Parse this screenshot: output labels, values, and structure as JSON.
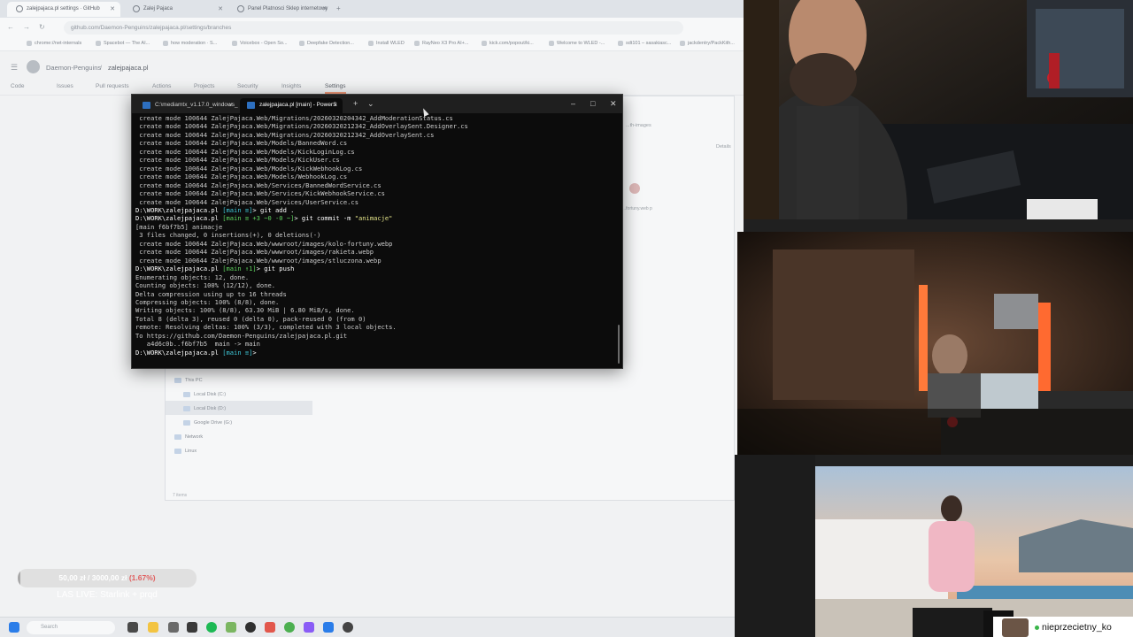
{
  "browser": {
    "tabs": [
      {
        "label": "zalejpajaca.pl settings · GitHub"
      },
      {
        "label": "Zalej Pajaca"
      },
      {
        "label": "Panel Platnosci Sklep internetowy"
      }
    ],
    "url": "github.com/Daemon-Penguins/zalejpajaca.pl/settings/branches",
    "bookmarks": [
      {
        "label": "chrome://net-internals"
      },
      {
        "label": "Spacebot — The AI..."
      },
      {
        "label": "how moderation · S..."
      },
      {
        "label": "Voicebox - Open So..."
      },
      {
        "label": "Deepfake Detection..."
      },
      {
        "label": "Install WLED"
      },
      {
        "label": "RayNeo X3 Pro AI+..."
      },
      {
        "label": "kick.com/popout/ki..."
      },
      {
        "label": "Welcome to WLED -..."
      },
      {
        "label": "sdt101 – sasakiasc..."
      },
      {
        "label": "jackdentry/PackKith..."
      }
    ],
    "repo": {
      "owner": "Daemon-Penguins",
      "name": "zalejpajaca.pl"
    },
    "repo_nav": [
      {
        "label": "Code"
      },
      {
        "label": "Issues"
      },
      {
        "label": "Pull requests"
      },
      {
        "label": "Actions"
      },
      {
        "label": "Projects"
      },
      {
        "label": "Security"
      },
      {
        "label": "Insights"
      },
      {
        "label": "Settings"
      }
    ]
  },
  "explorer": {
    "tree": [
      {
        "label": "This PC"
      },
      {
        "label": "Local Disk (C:)"
      },
      {
        "label": "Local Disk (D:)"
      },
      {
        "label": "Google Drive (G:)"
      },
      {
        "label": "Network"
      },
      {
        "label": "Linux"
      }
    ],
    "status": "7 items",
    "side_label": "Details",
    "header_label": "...th-images",
    "file_label": "...fortuny.web p"
  },
  "terminal": {
    "tabs": [
      {
        "label": "C:\\mediamtx_v1.17.0_windows_"
      },
      {
        "label": "zalejpajaca.pl [main] - PowerS"
      }
    ],
    "lines": [
      {
        "segs": [
          {
            "t": " create mode 100644 ZalejPajaca.Web/Migrations/20260320204342_AddModerationStatus.cs",
            "c": ""
          }
        ]
      },
      {
        "segs": [
          {
            "t": " create mode 100644 ZalejPajaca.Web/Migrations/20260320212342_AddOverlaySent.Designer.cs",
            "c": ""
          }
        ]
      },
      {
        "segs": [
          {
            "t": " create mode 100644 ZalejPajaca.Web/Migrations/20260320212342_AddOverlaySent.cs",
            "c": ""
          }
        ]
      },
      {
        "segs": [
          {
            "t": " create mode 100644 ZalejPajaca.Web/Models/BannedWord.cs",
            "c": ""
          }
        ]
      },
      {
        "segs": [
          {
            "t": " create mode 100644 ZalejPajaca.Web/Models/KickLoginLog.cs",
            "c": ""
          }
        ]
      },
      {
        "segs": [
          {
            "t": " create mode 100644 ZalejPajaca.Web/Models/KickUser.cs",
            "c": ""
          }
        ]
      },
      {
        "segs": [
          {
            "t": " create mode 100644 ZalejPajaca.Web/Models/KickWebhookLog.cs",
            "c": ""
          }
        ]
      },
      {
        "segs": [
          {
            "t": " create mode 100644 ZalejPajaca.Web/Models/WebhookLog.cs",
            "c": ""
          }
        ]
      },
      {
        "segs": [
          {
            "t": " create mode 100644 ZalejPajaca.Web/Services/BannedWordService.cs",
            "c": ""
          }
        ]
      },
      {
        "segs": [
          {
            "t": " create mode 100644 ZalejPajaca.Web/Services/KickWebhookService.cs",
            "c": ""
          }
        ]
      },
      {
        "segs": [
          {
            "t": " create mode 100644 ZalejPajaca.Web/Services/UserService.cs",
            "c": ""
          }
        ]
      },
      {
        "segs": [
          {
            "t": "D:\\WORK\\zalejpajaca.pl ",
            "c": "w"
          },
          {
            "t": "[main ≡]",
            "c": "c"
          },
          {
            "t": "> git add .",
            "c": "w"
          }
        ]
      },
      {
        "segs": [
          {
            "t": "D:\\WORK\\zalejpajaca.pl ",
            "c": "w"
          },
          {
            "t": "[main ≡ +3 ~0 -0 ~]",
            "c": "g"
          },
          {
            "t": "> git commit -m ",
            "c": "w"
          },
          {
            "t": "\"animacje\"",
            "c": "y"
          }
        ]
      },
      {
        "segs": [
          {
            "t": "[main f6bf7b5] animacje",
            "c": ""
          }
        ]
      },
      {
        "segs": [
          {
            "t": " 3 files changed, 0 insertions(+), 0 deletions(-)",
            "c": ""
          }
        ]
      },
      {
        "segs": [
          {
            "t": " create mode 100644 ZalejPajaca.Web/wwwroot/images/kolo-fortuny.webp",
            "c": ""
          }
        ]
      },
      {
        "segs": [
          {
            "t": " create mode 100644 ZalejPajaca.Web/wwwroot/images/rakieta.webp",
            "c": ""
          }
        ]
      },
      {
        "segs": [
          {
            "t": " create mode 100644 ZalejPajaca.Web/wwwroot/images/stluczona.webp",
            "c": ""
          }
        ]
      },
      {
        "segs": [
          {
            "t": "D:\\WORK\\zalejpajaca.pl ",
            "c": "w"
          },
          {
            "t": "[main ↑1]",
            "c": "g"
          },
          {
            "t": "> git push",
            "c": "w"
          }
        ]
      },
      {
        "segs": [
          {
            "t": "Enumerating objects: 12, done.",
            "c": ""
          }
        ]
      },
      {
        "segs": [
          {
            "t": "Counting objects: 100% (12/12), done.",
            "c": ""
          }
        ]
      },
      {
        "segs": [
          {
            "t": "Delta compression using up to 16 threads",
            "c": ""
          }
        ]
      },
      {
        "segs": [
          {
            "t": "Compressing objects: 100% (8/8), done.",
            "c": ""
          }
        ]
      },
      {
        "segs": [
          {
            "t": "Writing objects: 100% (8/8), 63.30 MiB | 6.80 MiB/s, done.",
            "c": ""
          }
        ]
      },
      {
        "segs": [
          {
            "t": "Total 8 (delta 3), reused 0 (delta 0), pack-reused 0 (from 0)",
            "c": ""
          }
        ]
      },
      {
        "segs": [
          {
            "t": "remote: Resolving deltas: 100% (3/3), completed with 3 local objects.",
            "c": ""
          }
        ]
      },
      {
        "segs": [
          {
            "t": "To https://github.com/Daemon-Penguins/zalejpajaca.pl.git",
            "c": ""
          }
        ]
      },
      {
        "segs": [
          {
            "t": "   a4d6c0b..f6bf7b5  main -> main",
            "c": ""
          }
        ]
      },
      {
        "segs": [
          {
            "t": "D:\\WORK\\zalejpajaca.pl ",
            "c": "w"
          },
          {
            "t": "[main ≡]",
            "c": "c"
          },
          {
            "t": "> ",
            "c": "w"
          }
        ]
      }
    ]
  },
  "donation": {
    "label_amount": "50,00 zł",
    "label_sep": " / ",
    "label_goal": "3000,00 zł",
    "label_pct": "(1.67%)",
    "progress_fraction": 0.0167
  },
  "ticker": "LAS LIVE: Starlink + prqd",
  "taskbar": {
    "search_placeholder": "Search"
  },
  "chat_badge": {
    "username": "nieprzecietny_ko"
  },
  "colors": {
    "terminal_bg": "#0c0c0c",
    "prompt_green": "#5fd35f",
    "prompt_cyan": "#3fc8d8",
    "string_yellow": "#e5e58a",
    "donation_pct": "#e06060",
    "online_dot": "#3ab54a"
  }
}
